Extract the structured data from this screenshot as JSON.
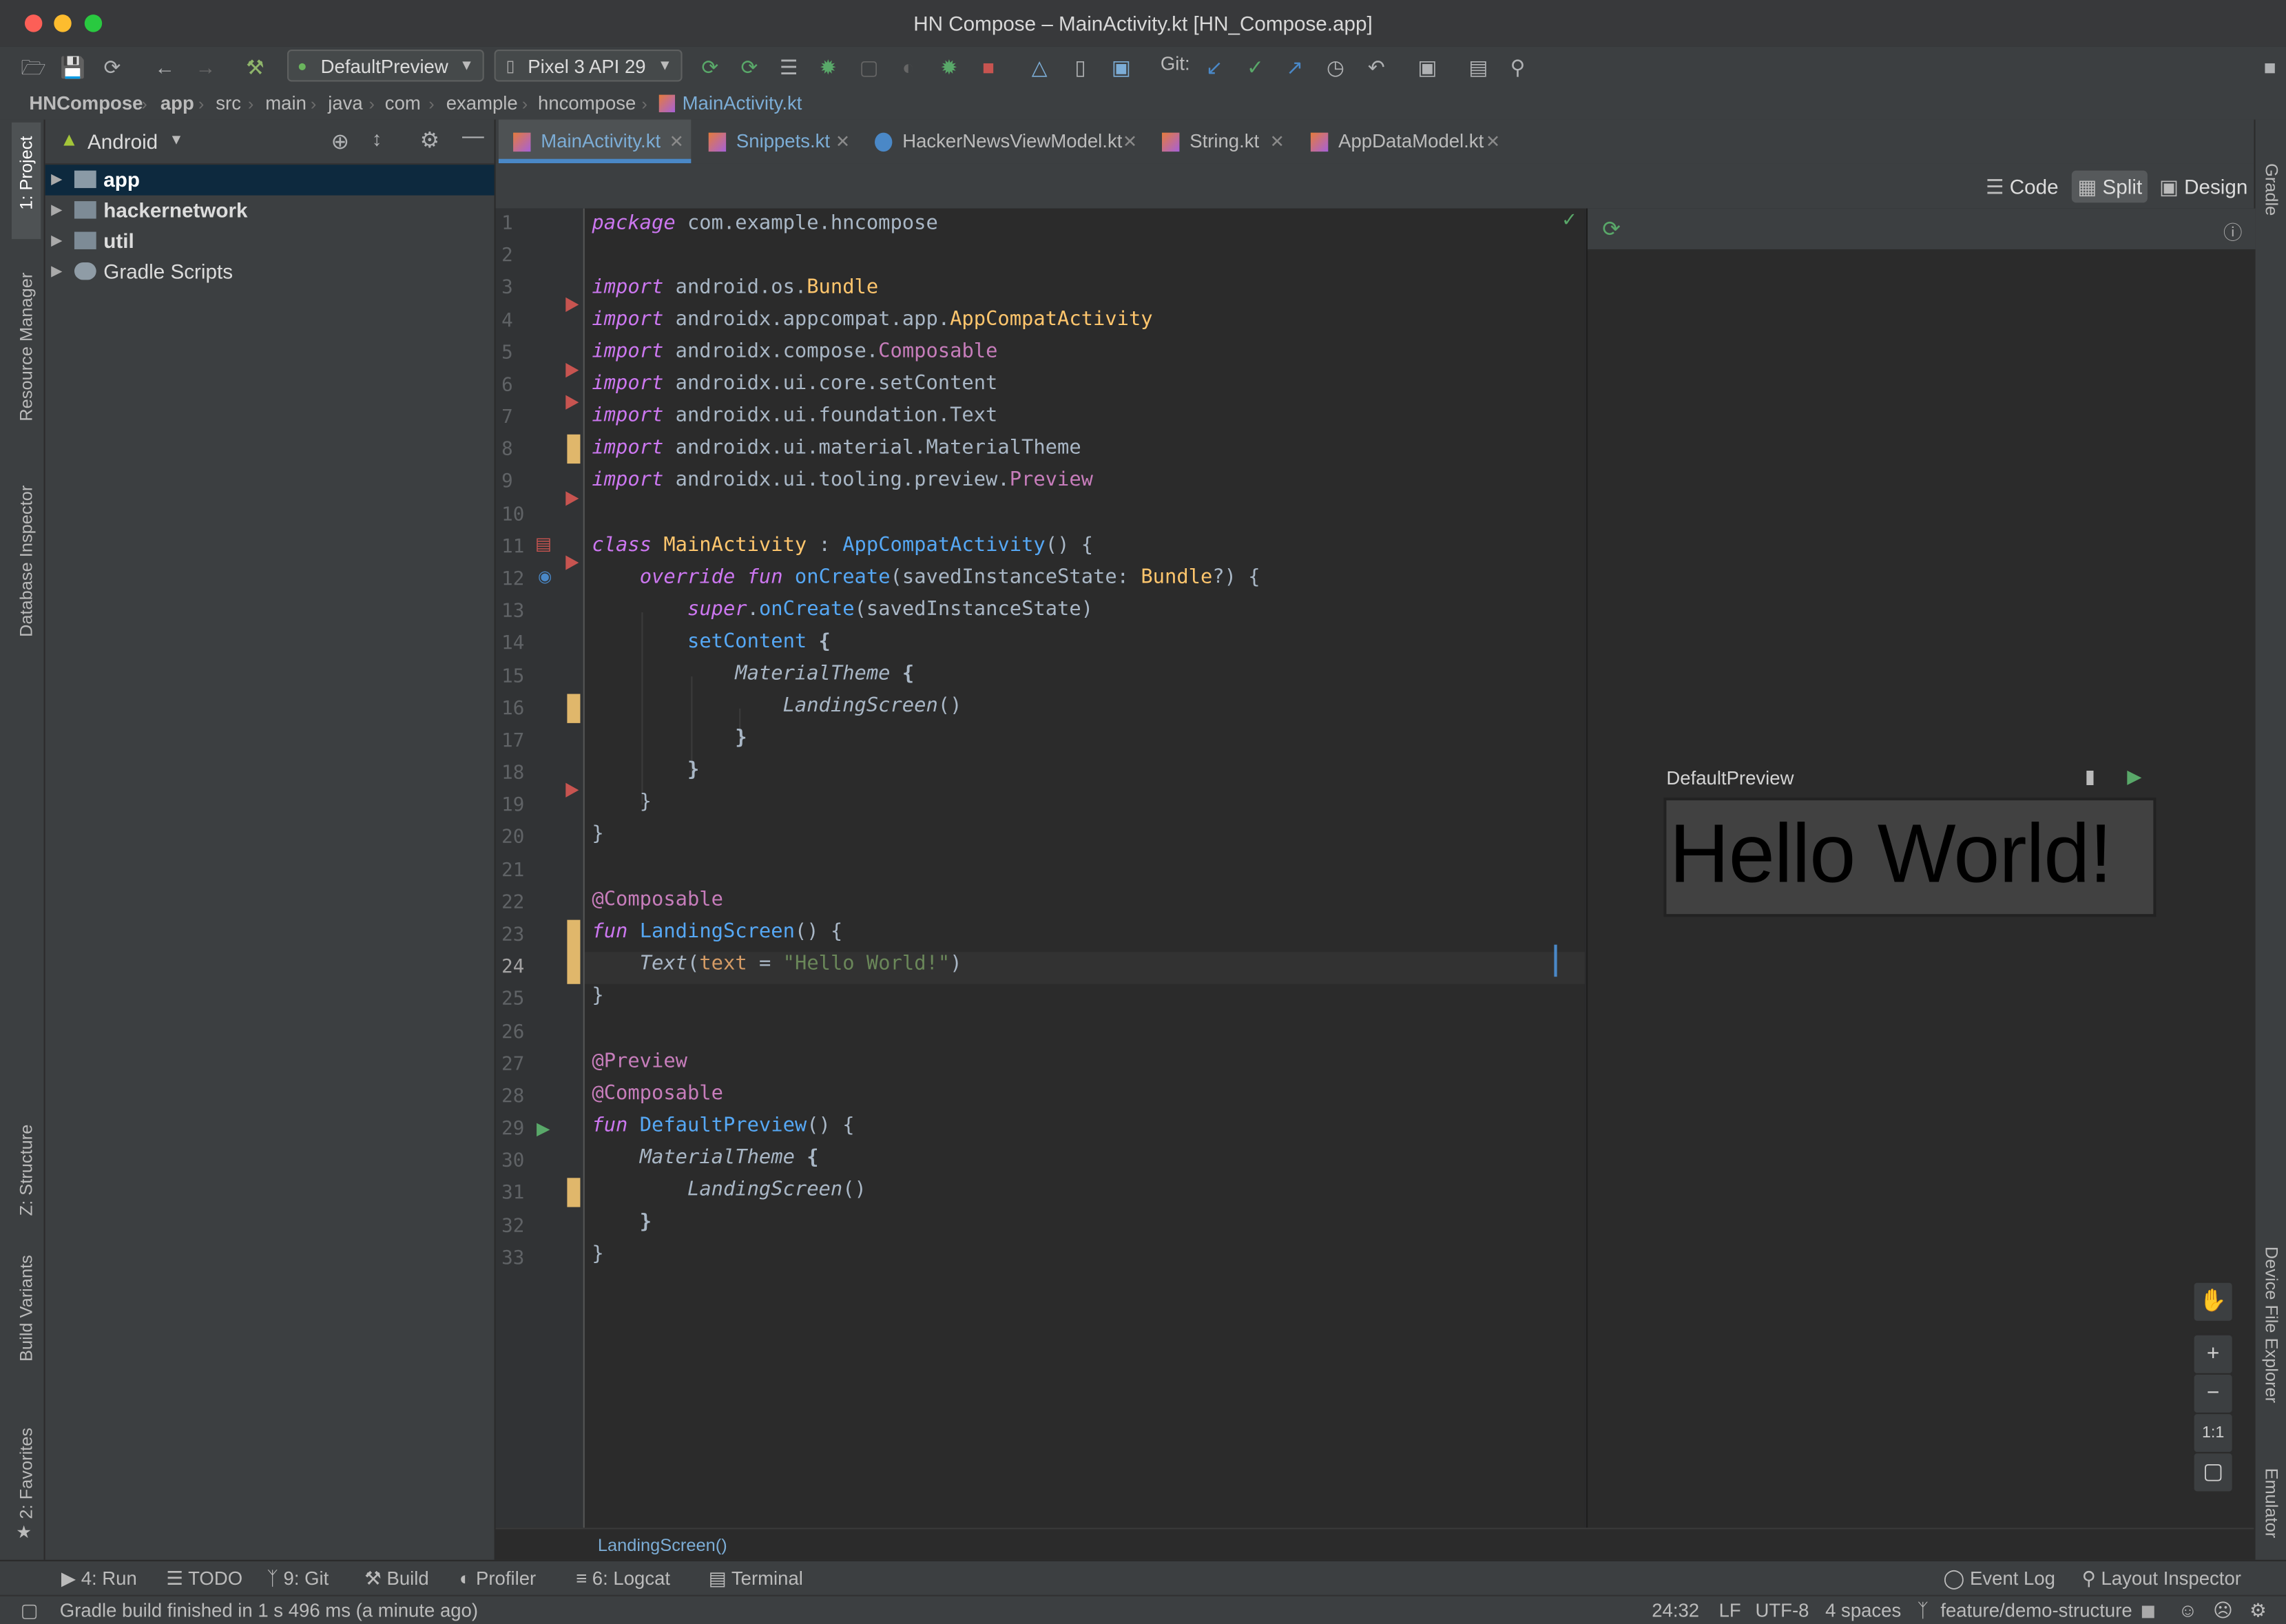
{
  "window": {
    "title": "HN Compose – MainActivity.kt [HN_Compose.app]"
  },
  "toolbar": {
    "run_config": "DefaultPreview",
    "device": "Pixel 3 API 29",
    "git_label": "Git:"
  },
  "breadcrumbs": [
    "HNCompose",
    "app",
    "src",
    "main",
    "java",
    "com",
    "example",
    "hncompose",
    "MainActivity.kt"
  ],
  "left_tools": {
    "project": "1: Project",
    "resource_manager": "Resource Manager",
    "database_inspector": "Database Inspector",
    "structure": "Z: Structure",
    "build_variants": "Build Variants",
    "favorites": "2: Favorites"
  },
  "right_tools": {
    "gradle": "Gradle",
    "device_file_explorer": "Device File Explorer",
    "emulator": "Emulator"
  },
  "project": {
    "view_mode": "Android",
    "items": [
      {
        "label": "app",
        "selected": true
      },
      {
        "label": "hackernetwork",
        "selected": false
      },
      {
        "label": "util",
        "selected": false
      },
      {
        "label": "Gradle Scripts",
        "selected": false
      }
    ]
  },
  "tabs": [
    {
      "label": "MainActivity.kt",
      "active": true
    },
    {
      "label": "Snippets.kt",
      "active": false
    },
    {
      "label": "HackerNewsViewModel.kt",
      "active": false
    },
    {
      "label": "String.kt",
      "active": false
    },
    {
      "label": "AppDataModel.kt",
      "active": false
    }
  ],
  "view_modes": {
    "code": "Code",
    "split": "Split",
    "design": "Design"
  },
  "editor": {
    "current_line": 24,
    "line_numbers": [
      "1",
      "2",
      "3",
      "4",
      "5",
      "6",
      "7",
      "8",
      "9",
      "10",
      "11",
      "12",
      "13",
      "14",
      "15",
      "16",
      "17",
      "18",
      "19",
      "20",
      "21",
      "22",
      "23",
      "24",
      "25",
      "26",
      "27",
      "28",
      "29",
      "30",
      "31",
      "32",
      "33"
    ]
  },
  "preview": {
    "name": "DefaultPreview",
    "text": "Hello World!",
    "zoom_reset": "1:1"
  },
  "code_breadcrumb": "LandingScreen()",
  "bottom_tools": {
    "run": "4: Run",
    "todo": "TODO",
    "git": "9: Git",
    "build": "Build",
    "profiler": "Profiler",
    "logcat": "6: Logcat",
    "terminal": "Terminal",
    "event_log": "Event Log",
    "layout_inspector": "Layout Inspector"
  },
  "status": {
    "message": "Gradle build finished in 1 s 496 ms (a minute ago)",
    "position": "24:32",
    "line_sep": "LF",
    "encoding": "UTF-8",
    "indent": "4 spaces",
    "branch": "feature/demo-structure"
  },
  "colors": {
    "accent": "#4a88c7",
    "keyword": "#cc7832",
    "function": "#ffc66d",
    "string": "#6a8759",
    "error_marker": "#c75450",
    "change_marker": "#e0b76b"
  }
}
